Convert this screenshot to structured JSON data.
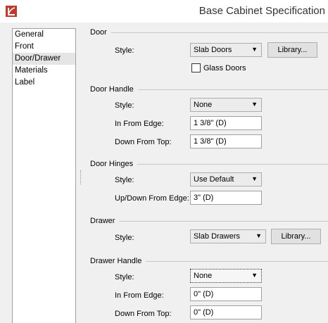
{
  "window": {
    "title": "Base Cabinet Specification"
  },
  "nav": {
    "items": [
      "General",
      "Front",
      "Door/Drawer",
      "Materials",
      "Label"
    ],
    "selected": "Door/Drawer"
  },
  "door": {
    "group_title": "Door",
    "style_label": "Style:",
    "style_value": "Slab Doors",
    "library_label": "Library...",
    "glass_label": "Glass Doors",
    "glass_checked": false
  },
  "door_handle": {
    "group_title": "Door Handle",
    "style_label": "Style:",
    "style_value": "None",
    "in_from_edge_label": "In From Edge:",
    "in_from_edge_value": "1 3/8\" (D)",
    "down_from_top_label": "Down From Top:",
    "down_from_top_value": "1 3/8\" (D)"
  },
  "door_hinges": {
    "group_title": "Door Hinges",
    "style_label": "Style:",
    "style_value": "Use Default",
    "updown_label": "Up/Down From Edge:",
    "updown_value": "3\" (D)"
  },
  "drawer": {
    "group_title": "Drawer",
    "style_label": "Style:",
    "style_value": "Slab Drawers",
    "library_label": "Library..."
  },
  "drawer_handle": {
    "group_title": "Drawer Handle",
    "style_label": "Style:",
    "style_value": "None",
    "in_from_edge_label": "In From Edge:",
    "in_from_edge_value": "0\" (D)",
    "down_from_top_label": "Down From Top:",
    "down_from_top_value": "0\" (D)"
  },
  "colors": {
    "app_icon": "#c0392b",
    "dialog_bg": "#f0f0f0"
  },
  "icons": {
    "app": "app-icon",
    "dropdown": "chevron-down-icon"
  }
}
